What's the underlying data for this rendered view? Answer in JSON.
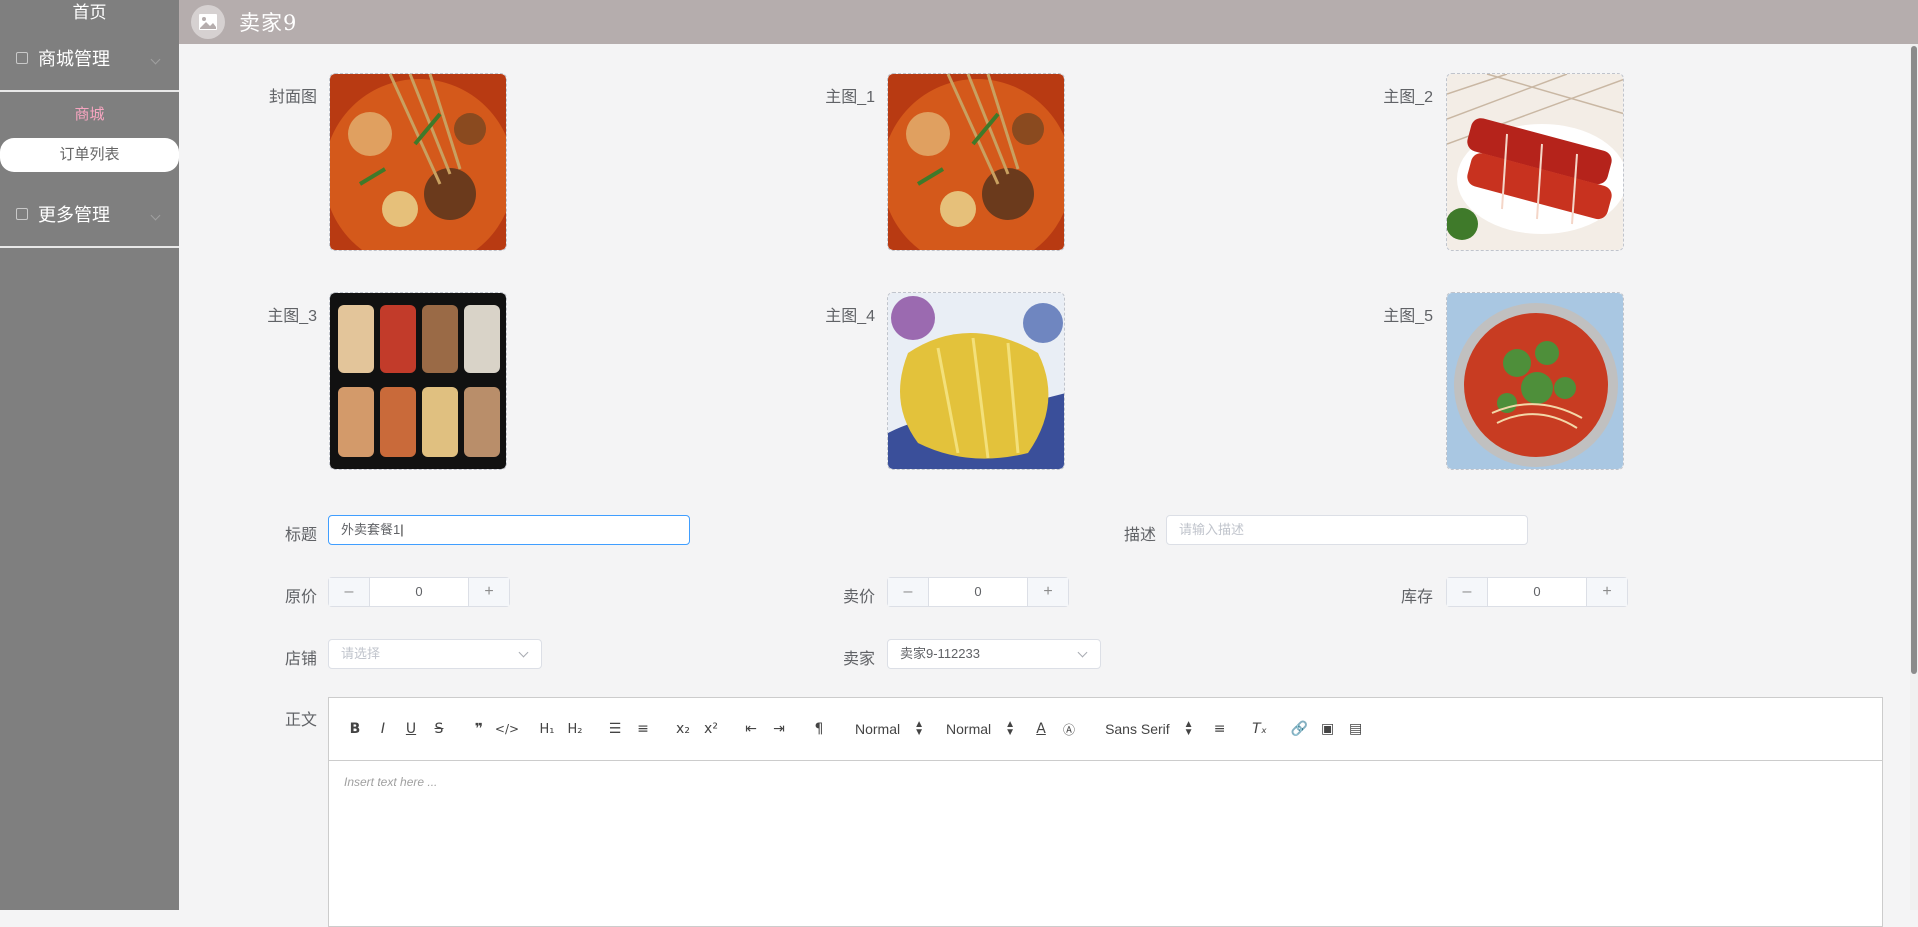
{
  "sidebar": {
    "home": "首页",
    "mall_mgmt": "商城管理",
    "mall": "商城",
    "orders": "订单列表",
    "more_mgmt": "更多管理"
  },
  "topbar": {
    "title": "卖家9"
  },
  "images": {
    "cover": "封面图",
    "main1": "主图_1",
    "main2": "主图_2",
    "main3": "主图_3",
    "main4": "主图_4",
    "main5": "主图_5"
  },
  "form": {
    "title_label": "标题",
    "title_value": "外卖套餐1",
    "desc_label": "描述",
    "desc_placeholder": "请输入描述",
    "orig_price_label": "原价",
    "orig_price": "0",
    "sale_price_label": "卖价",
    "sale_price": "0",
    "stock_label": "库存",
    "stock": "0",
    "shop_label": "店铺",
    "shop_placeholder": "请选择",
    "seller_label": "卖家",
    "seller_value": "卖家9-112233",
    "body_label": "正文"
  },
  "editor": {
    "header_select": "Normal",
    "size_select": "Normal",
    "font_select": "Sans Serif",
    "placeholder": "Insert text here ..."
  }
}
